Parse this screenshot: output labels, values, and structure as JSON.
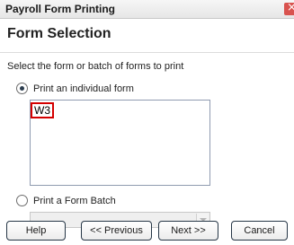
{
  "window": {
    "title": "Payroll Form Printing"
  },
  "page": {
    "heading": "Form Selection",
    "instruction": "Select the form or batch of forms to print"
  },
  "options": {
    "individual": {
      "label": "Print an individual form",
      "selected": true
    },
    "batch": {
      "label": "Print a Form Batch",
      "selected": false
    }
  },
  "forms_list": {
    "items": [
      "W3"
    ],
    "selected_index": 0
  },
  "batch_combo": {
    "value": ""
  },
  "buttons": {
    "help": "Help",
    "previous": "<< Previous",
    "next": "Next >>",
    "cancel": "Cancel"
  }
}
